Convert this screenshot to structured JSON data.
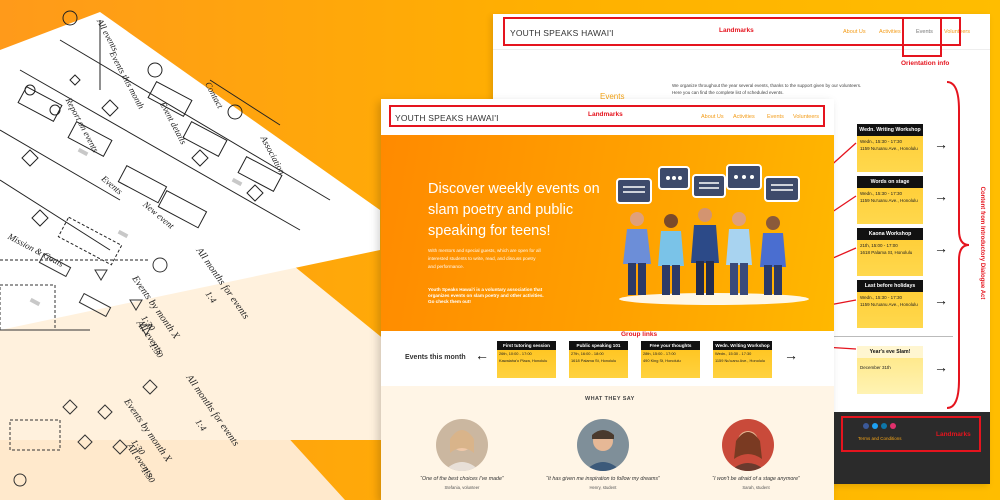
{
  "diagram_labels": {
    "sheet1": [
      "Report on events",
      "Events this month",
      "All events",
      "Association",
      "Events",
      "New event",
      "Event details",
      "Contact",
      "Mission & Goals"
    ],
    "sheet2": [
      "All months for events",
      "1:4",
      "Events by month X",
      "1:30",
      "All events",
      "1:30"
    ],
    "sheet3": [
      "All months for events",
      "1:4",
      "Events by month X",
      "1:30",
      "All events",
      "1:30"
    ]
  },
  "back_page": {
    "brand": "YOUTH SPEAKS HAWAI'I",
    "landmarks": "Landmarks",
    "nav": [
      "About Us",
      "Activities",
      "Events",
      "Volunteers"
    ],
    "orientation_info": "Orientation info",
    "events_title": "Events",
    "intro": [
      "We organize throughout the year several events, thanks to the support given by our volunteers.",
      "Here you can find the complete list of scheduled events."
    ],
    "content_label": "Content from Introductory Dialogue Act",
    "events": [
      {
        "title": "Wedn. Writing Workshop",
        "date": "Wedn., 15:30 - 17:30",
        "place": "1159 Nu'uanu Ave., Honolulu"
      },
      {
        "title": "Words on stage",
        "date": "Wedn., 15:30 - 17:30",
        "place": "1159 Nu'uanu Ave., Honolulu"
      },
      {
        "title": "Kaona Workshop",
        "date": "21th, 15:00 - 17:00",
        "place": "1618 Palama St, Honolulu"
      },
      {
        "title": "Last before holidays",
        "date": "Wedn., 15:30 - 17:30",
        "place": "1159 Nu'uanu Ave., Honolulu"
      },
      {
        "title": "Year's eve Slam!",
        "date": "December 31th",
        "place": ""
      }
    ],
    "footer_terms": "Terms and Conditions",
    "footer_landmarks": "Landmarks"
  },
  "front_page": {
    "brand": "YOUTH SPEAKS HAWAI'I",
    "landmarks": "Landmarks",
    "nav": [
      "About Us",
      "Activities",
      "Events",
      "Volunteers"
    ],
    "hero_heading": [
      "Discover weekly events on",
      "slam poetry and public",
      "speaking for teens!"
    ],
    "hero_text": [
      "With mentors and special guests, which are open for all",
      "interested students to write, read, and discuss poetry",
      "and performance."
    ],
    "hero_bold": [
      "Youth Speaks Hawai'i is a voluntary association that",
      "organizes events on slam poetry and other activities.",
      "Go check them out!"
    ],
    "events_month_title": "Events this month",
    "group_links": "Group links",
    "events": [
      {
        "title": "First tutoring session",
        "date": "26th, 10:00 - 17:00",
        "place": "Kawaiaha'o Plaza, Honolulu"
      },
      {
        "title": "Public speaking 101",
        "date": "27th, 16:00 - 18:00",
        "place": "1618 Palama St, Honolulu"
      },
      {
        "title": "Free your thoughts",
        "date": "28th, 15:00 - 17:00",
        "place": "490 King St, Honolulu"
      },
      {
        "title": "Wedn. Writing Workshop",
        "date": "Wedn., 15:30 - 17:30",
        "place": "1159 Nu'uanu Ave., Honolulu"
      }
    ],
    "what_they_say": "WHAT THEY SAY",
    "testimonials": [
      {
        "quote": "“One of the best choices I've made”",
        "author": "Stefania, volunteer"
      },
      {
        "quote": "“It has given me inspiration to follow my dreams”",
        "author": "Henry, student"
      },
      {
        "quote": "“I won't be afraid of a stage anymore”",
        "author": "Sarah, student"
      }
    ]
  },
  "colors": {
    "background": "#ffa500",
    "accent": "#f39b16",
    "annotation": "#e5141e",
    "card_header": "#111111",
    "card_body": "#ffcc33"
  }
}
